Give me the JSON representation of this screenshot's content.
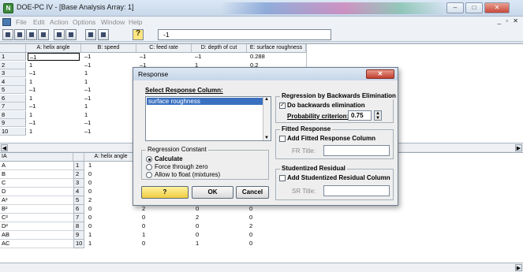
{
  "window": {
    "icon_label": "N",
    "title": "DOE-PC IV - [Base Analysis Array: 1]",
    "controls": {
      "minimize": "–",
      "maximize": "□",
      "close": "✕",
      "mdi": "_ ▫ ✕"
    }
  },
  "menu": [
    "File",
    "Edit",
    "Action",
    "Options",
    "Window",
    "Help"
  ],
  "toolbar": {
    "cell_value": "-1"
  },
  "grid1": {
    "headers": [
      "A: helix angle",
      "B: speed",
      "C: feed rate",
      "D: depth of cut",
      "E: surface roughness"
    ],
    "rows": [
      {
        "n": "1",
        "c": [
          "–1",
          "–1",
          "–1",
          "–1",
          "0.288"
        ]
      },
      {
        "n": "2",
        "c": [
          "1",
          "–1",
          "–1",
          "1",
          "0.2"
        ]
      },
      {
        "n": "3",
        "c": [
          "–1",
          "1",
          "–1",
          "",
          ""
        ]
      },
      {
        "n": "4",
        "c": [
          "1",
          "1",
          "",
          "",
          ""
        ]
      },
      {
        "n": "5",
        "c": [
          "–1",
          "–1",
          "",
          "",
          ""
        ]
      },
      {
        "n": "6",
        "c": [
          "1",
          "–1",
          "",
          "",
          ""
        ]
      },
      {
        "n": "7",
        "c": [
          "–1",
          "1",
          "",
          "",
          ""
        ]
      },
      {
        "n": "8",
        "c": [
          "1",
          "1",
          "",
          "",
          ""
        ]
      },
      {
        "n": "9",
        "c": [
          "–1",
          "–1",
          "",
          "",
          ""
        ]
      },
      {
        "n": "10",
        "c": [
          "1",
          "–1",
          "",
          "",
          ""
        ]
      }
    ]
  },
  "grid2": {
    "corner": "IA",
    "header": "A: helix angle",
    "rows": [
      {
        "label": "A",
        "n": "1",
        "v": [
          "1",
          "",
          "",
          ""
        ]
      },
      {
        "label": "B",
        "n": "2",
        "v": [
          "0",
          "",
          "",
          ""
        ]
      },
      {
        "label": "C",
        "n": "3",
        "v": [
          "0",
          "",
          "",
          ""
        ]
      },
      {
        "label": "D",
        "n": "4",
        "v": [
          "0",
          "",
          "",
          ""
        ]
      },
      {
        "label": "A²",
        "n": "5",
        "v": [
          "2",
          "",
          "",
          ""
        ]
      },
      {
        "label": "B²",
        "n": "6",
        "v": [
          "0",
          "2",
          "0",
          "0"
        ]
      },
      {
        "label": "C²",
        "n": "7",
        "v": [
          "0",
          "0",
          "2",
          "0"
        ]
      },
      {
        "label": "D²",
        "n": "8",
        "v": [
          "0",
          "0",
          "0",
          "2"
        ]
      },
      {
        "label": "AB",
        "n": "9",
        "v": [
          "1",
          "1",
          "0",
          "0"
        ]
      },
      {
        "label": "AC",
        "n": "10",
        "v": [
          "1",
          "0",
          "1",
          "0"
        ]
      }
    ]
  },
  "dialog": {
    "title": "Response",
    "select_label": "Select Response Column:",
    "response_options": [
      "surface roughness"
    ],
    "regression_constant": {
      "title": "Regression Constant",
      "options": [
        "Calculate",
        "Force through zero",
        "Allow to float (mixtures)"
      ],
      "selected": 0
    },
    "backwards": {
      "title": "Regression by Backwards Elimination",
      "checkbox": "Do backwards elimination",
      "checked": true,
      "prob_label": "Probability criterion:",
      "prob_value": "0.75"
    },
    "fitted": {
      "title": "Fitted Response",
      "checkbox": "Add Fitted Response Column",
      "title_label": "FR Title:"
    },
    "studentized": {
      "title": "Studentized Residual",
      "checkbox": "Add Studentized Residual Column",
      "title_label": "SR Title:"
    },
    "buttons": {
      "help": "?",
      "ok": "OK",
      "cancel": "Cancel"
    }
  }
}
